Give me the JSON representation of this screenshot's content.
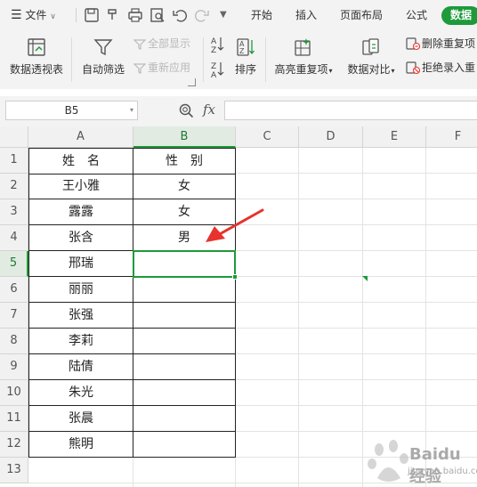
{
  "menubar": {
    "file_label": "文件",
    "tabs": [
      "开始",
      "插入",
      "页面布局",
      "公式"
    ],
    "active_tab": "数据"
  },
  "ribbon": {
    "pivot_label": "数据透视表",
    "autofilter_label": "自动筛选",
    "show_all_label": "全部显示",
    "reapply_label": "重新应用",
    "sort_label": "排序",
    "highlight_dup_label": "高亮重复项",
    "compare_label": "数据对比",
    "remove_dup_label": "删除重复项",
    "reject_dup_label": "拒绝录入重"
  },
  "formula_bar": {
    "name_box": "B5",
    "fx_label": "fx",
    "formula": ""
  },
  "sheet": {
    "columns": [
      "A",
      "B",
      "C",
      "D",
      "E",
      "F"
    ],
    "active_column": "B",
    "rows": [
      "1",
      "2",
      "3",
      "4",
      "5",
      "6",
      "7",
      "8",
      "9",
      "10",
      "11",
      "12",
      "13"
    ],
    "active_row": "5",
    "header": {
      "name": "姓　名",
      "gender": "性　别"
    },
    "names": [
      "王小雅",
      "露露",
      "张含",
      "邢瑞",
      "丽丽",
      "张强",
      "李莉",
      "陆倩",
      "朱光",
      "张晨",
      "熊明"
    ],
    "genders": [
      "女",
      "女",
      "男",
      "",
      "",
      "",
      "",
      "",
      "",
      "",
      ""
    ]
  },
  "annotation": {
    "arrow_color": "#e8322d"
  },
  "colors": {
    "accent": "#1e9a3b"
  },
  "watermark": {
    "text": "Baidu 经验",
    "sub": "jingyan.baidu.com"
  }
}
